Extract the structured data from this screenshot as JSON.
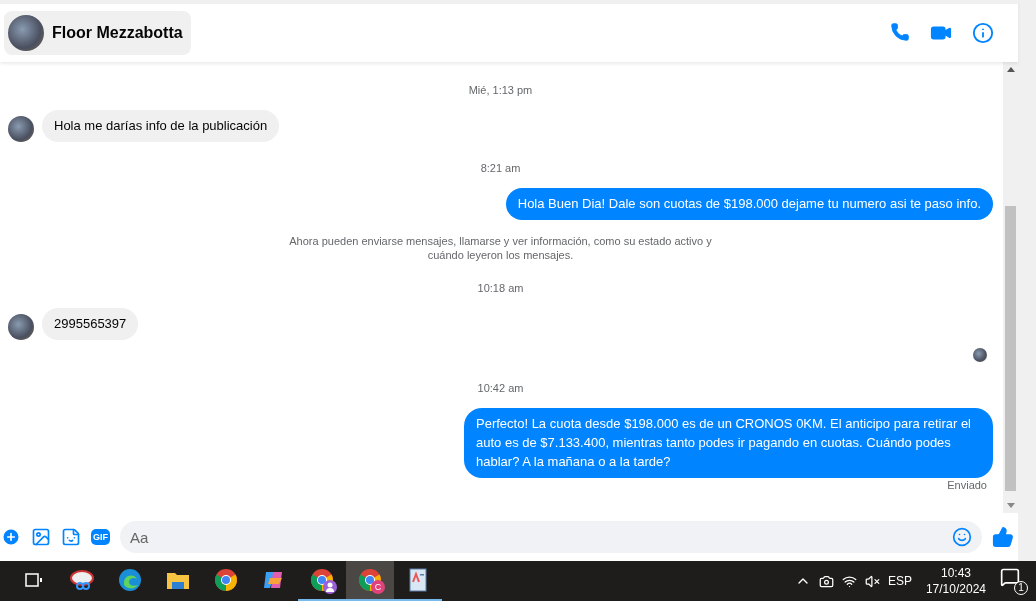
{
  "header": {
    "contact_name": "Floor Mezzabotta"
  },
  "messages": [
    {
      "kind": "timestamp",
      "text": "Mié, 1:13 pm"
    },
    {
      "kind": "incoming",
      "text": "Hola me darías info de la publicación"
    },
    {
      "kind": "timestamp",
      "text": "8:21 am"
    },
    {
      "kind": "outgoing",
      "text": "Hola Buen Dia! Dale son cuotas de $198.000 dejame tu numero asi te paso info."
    },
    {
      "kind": "notice",
      "text": "Ahora pueden enviarse mensajes, llamarse y ver información, como su estado activo y cuándo leyeron los mensajes."
    },
    {
      "kind": "timestamp",
      "text": "10:18 am"
    },
    {
      "kind": "incoming",
      "text": "2995565397"
    },
    {
      "kind": "read_receipt"
    },
    {
      "kind": "timestamp",
      "text": "10:42 am"
    },
    {
      "kind": "outgoing",
      "text": "Perfecto! La cuota desde $198.000 es de un CRONOS 0KM. El anticipo para retirar el auto es de $7.133.400, mientras tanto podes ir pagando en cuotas. Cuándo podes hablar? A la mañana o a la tarde?"
    },
    {
      "kind": "status",
      "text": "Enviado"
    }
  ],
  "composer": {
    "placeholder": "Aa",
    "gif_label": "GIF"
  },
  "taskbar": {
    "apps": [
      {
        "kind": "taskview",
        "running": false,
        "active": false
      },
      {
        "kind": "snip",
        "running": false,
        "active": false
      },
      {
        "kind": "edge",
        "running": false,
        "active": false
      },
      {
        "kind": "folder",
        "running": false,
        "active": false
      },
      {
        "kind": "chrome",
        "running": false,
        "active": false
      },
      {
        "kind": "copilot",
        "running": false,
        "active": false
      },
      {
        "kind": "chrome",
        "running": true,
        "active": false,
        "profile_badge": true
      },
      {
        "kind": "chrome",
        "running": true,
        "active": true,
        "badge": "C"
      },
      {
        "kind": "wordpad",
        "running": true,
        "active": false
      }
    ],
    "language": "ESP",
    "time": "10:43",
    "date": "17/10/2024",
    "notification_count": "1"
  }
}
